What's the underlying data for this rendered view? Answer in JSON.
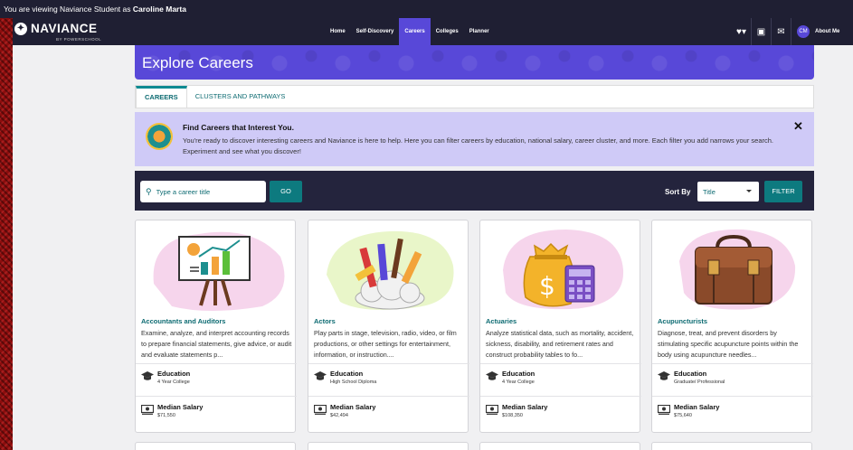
{
  "viewing": {
    "prefix": "You are viewing Naviance Student as",
    "name": "Caroline Marta"
  },
  "logo": {
    "text": "NAVIANCE",
    "sub": "BY POWERSCHOOL"
  },
  "nav": {
    "items": [
      {
        "label": "Home"
      },
      {
        "label": "Self-Discovery"
      },
      {
        "label": "Careers",
        "active": true
      },
      {
        "label": "Colleges"
      },
      {
        "label": "Planner"
      }
    ]
  },
  "user": {
    "initials": "CM",
    "about_label": "About Me"
  },
  "banner": {
    "title": "Explore Careers"
  },
  "tabs": [
    {
      "label": "CAREERS",
      "active": true
    },
    {
      "label": "CLUSTERS AND PATHWAYS"
    }
  ],
  "info": {
    "title": "Find Careers that Interest You.",
    "text": "You're ready to discover interesting careers and Naviance is here to help. Here you can filter careers by education, national salary, career cluster, and more. Each filter you add narrows your search. Experiment and see what you discover!",
    "close": "✕"
  },
  "search": {
    "placeholder": "Type a career title",
    "go_label": "GO",
    "sort_label": "Sort By",
    "sort_value": "Title",
    "filter_label": "FILTER"
  },
  "meta_labels": {
    "education": "Education",
    "salary": "Median Salary"
  },
  "cards": [
    {
      "title": "Accountants and Auditors",
      "desc": "Examine, analyze, and interpret accounting records to prepare financial statements, give advice, or audit and evaluate statements p...",
      "education": "4 Year College",
      "salary": "$71,550"
    },
    {
      "title": "Actors",
      "desc": "Play parts in stage, television, radio, video, or film productions, or other settings for entertainment, information, or instruction....",
      "education": "High School Diploma",
      "salary": "$42,494"
    },
    {
      "title": "Actuaries",
      "desc": "Analyze statistical data, such as mortality, accident, sickness, disability, and retirement rates and construct probability tables to fo...",
      "education": "4 Year College",
      "salary": "$108,350"
    },
    {
      "title": "Acupuncturists",
      "desc": "Diagnose, treat, and prevent disorders by stimulating specific acupuncture points within the body using acupuncture needles...",
      "education": "Graduate/ Professional",
      "salary": "$75,640"
    }
  ],
  "colors": {
    "brand_purple": "#5848d8",
    "nav_dark": "#1f1f33",
    "teal": "#0d7a7f",
    "info_bg": "#cfcaf7"
  }
}
